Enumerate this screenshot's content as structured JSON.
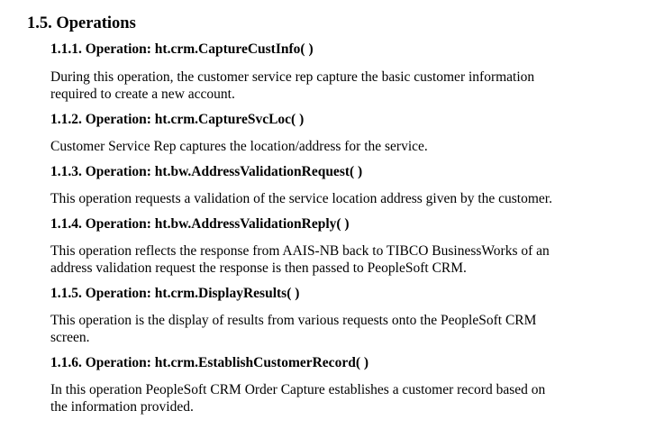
{
  "section": {
    "title": "1.5. Operations"
  },
  "operations": [
    {
      "heading": "1.1.1. Operation: ht.crm.CaptureCustInfo( )",
      "lines": [
        "During this operation, the customer service rep capture the basic customer information",
        "required to create a new account."
      ]
    },
    {
      "heading": "1.1.2. Operation: ht.crm.CaptureSvcLoc( )",
      "lines": [
        "Customer Service Rep captures the location/address for the service."
      ]
    },
    {
      "heading": "1.1.3. Operation: ht.bw.AddressValidationRequest( )",
      "lines": [
        "This operation requests a validation of the service location address given by the customer."
      ]
    },
    {
      "heading": "1.1.4. Operation: ht.bw.AddressValidationReply( )",
      "lines": [
        "This operation reflects the response from AAIS-NB back to TIBCO BusinessWorks of an",
        "address validation request the response is then passed to PeopleSoft CRM."
      ]
    },
    {
      "heading": "1.1.5. Operation: ht.crm.DisplayResults( )",
      "lines": [
        "This operation is the display of results from various requests onto the PeopleSoft CRM",
        "screen."
      ]
    },
    {
      "heading": "1.1.6. Operation: ht.crm.EstablishCustomerRecord( )",
      "lines": [
        "In this operation PeopleSoft CRM Order Capture establishes a customer record based on",
        "the information provided."
      ]
    }
  ]
}
